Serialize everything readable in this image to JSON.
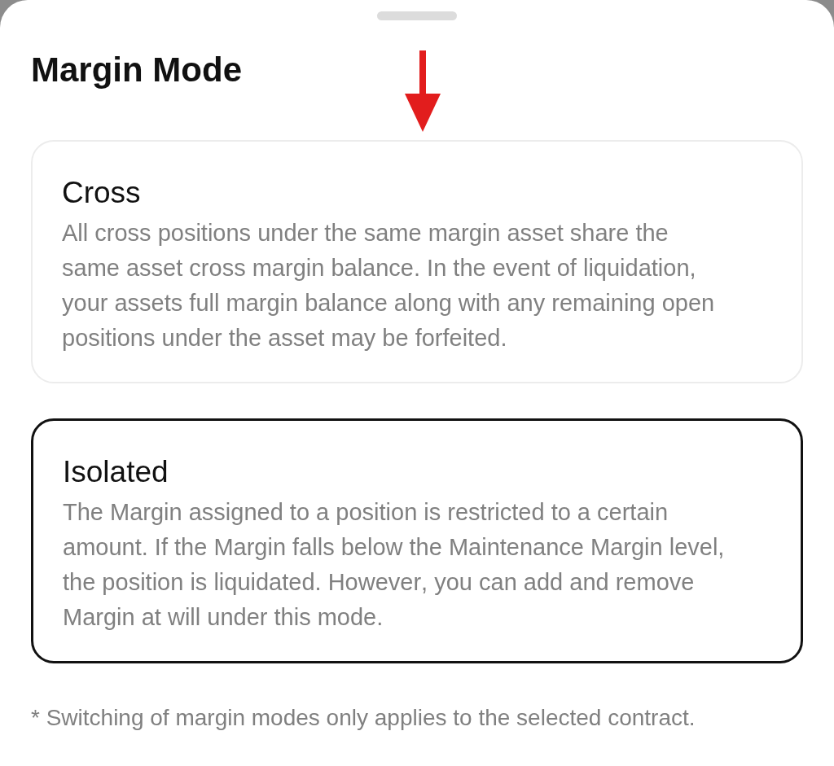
{
  "title": "Margin Mode",
  "options": [
    {
      "title": "Cross",
      "description": "All cross positions under the same margin asset share the same asset cross margin balance. In the event of liquidation, your assets full margin balance along with any remaining open positions under the asset may be forfeited.",
      "selected": false
    },
    {
      "title": "Isolated",
      "description": "The Margin assigned to a position is restricted to a certain amount. If the Margin falls below the Maintenance Margin level, the position is liquidated. However, you can add and remove Margin at will under this mode.",
      "selected": true
    }
  ],
  "footnote": "* Switching of margin modes only applies to the selected contract."
}
